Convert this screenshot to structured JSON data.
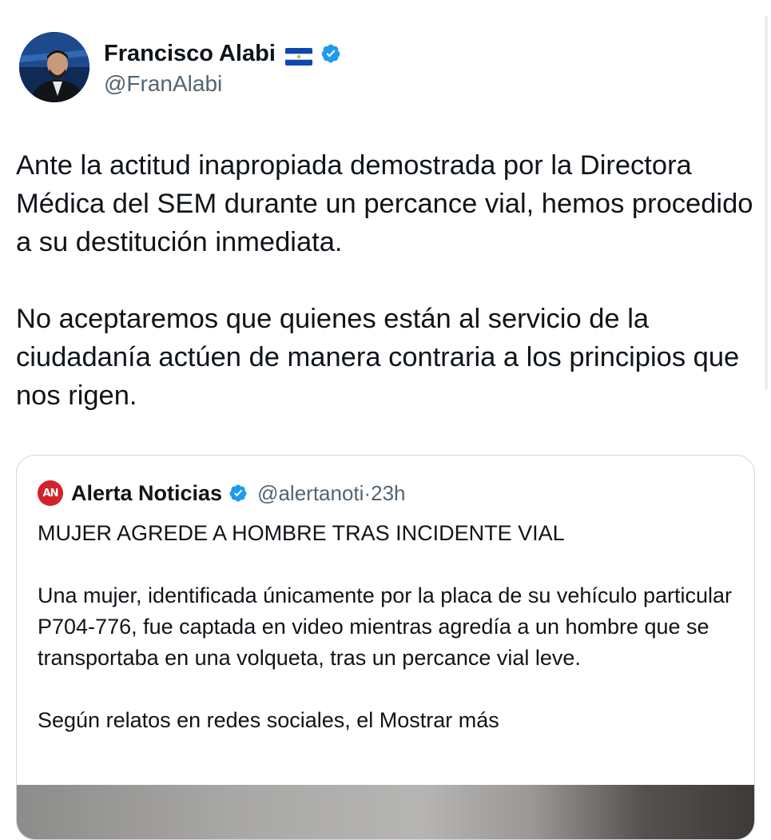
{
  "tweet": {
    "author": {
      "name": "Francisco Alabi",
      "handle": "@FranAlabi",
      "flag_icon": "el-salvador-flag-icon",
      "verified_icon": "verified-badge-icon"
    },
    "paragraphs": [
      "Ante la actitud inapropiada demostrada por la Directora Médica del SEM durante un percance vial, hemos procedido a su destitución inmediata.",
      "No aceptaremos que quienes están al servicio de la ciudadanía actúen de manera contraria a los principios que nos rigen."
    ]
  },
  "quoted_tweet": {
    "avatar_text": "AN",
    "name": "Alerta Noticias",
    "handle": "@alertanoti",
    "separator": "·",
    "time": "23h",
    "headline": "MUJER AGREDE A HOMBRE TRAS INCIDENTE VIAL",
    "body": "Una mujer, identificada únicamente por la placa de su vehículo particular P704-776, fue captada en video mientras agredía a un hombre que se transportaba en una volqueta, tras un percance vial leve.",
    "truncated_text": "Según relatos en redes sociales, el",
    "show_more_label": "Mostrar más"
  },
  "colors": {
    "text_primary": "#0f1419",
    "text_secondary": "#536471",
    "verified_blue": "#1d9bf0",
    "border": "#cfd9de",
    "alerta_red": "#d1232a"
  }
}
